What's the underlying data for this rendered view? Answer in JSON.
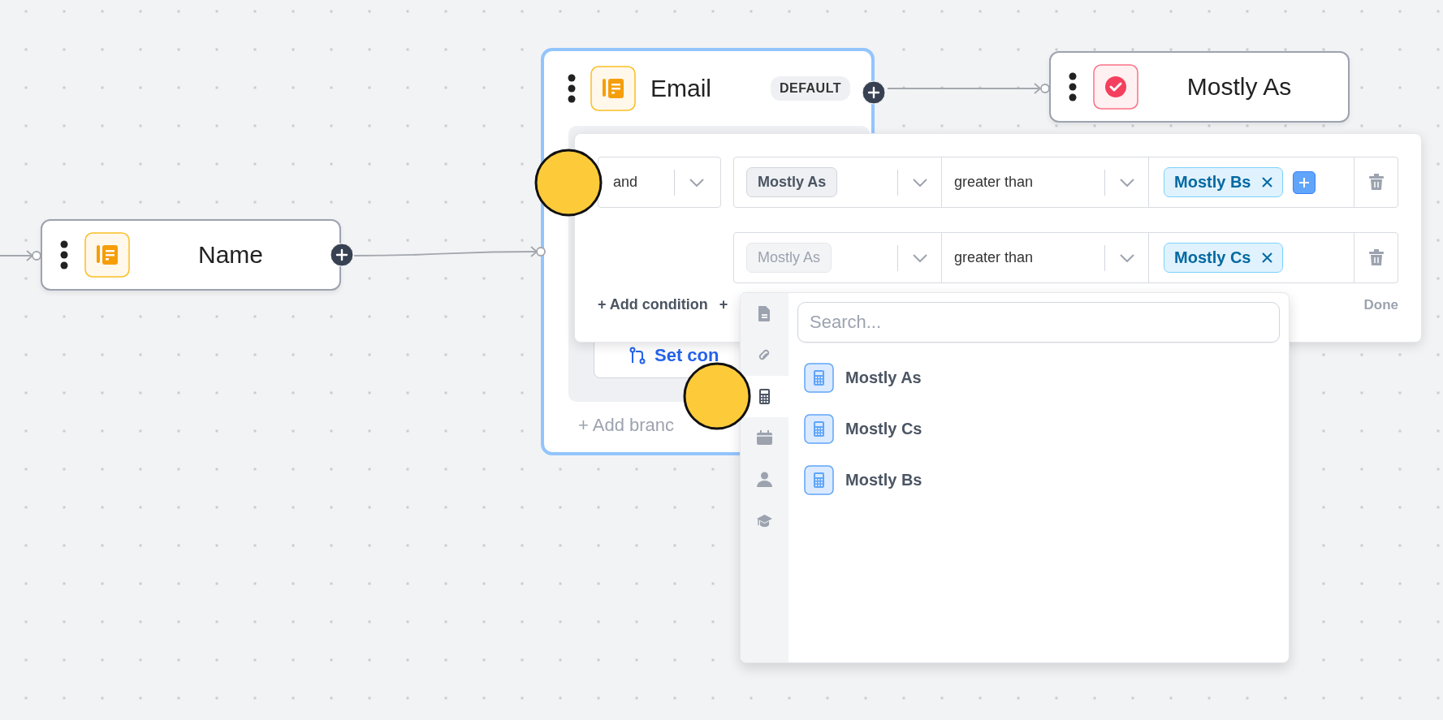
{
  "nodes": [
    {
      "kind": "form",
      "title": "Name",
      "selected": false
    },
    {
      "kind": "outcome",
      "title": "Mostly As",
      "selected": false
    }
  ],
  "branch_node": {
    "kind": "form",
    "title": "Email",
    "badge": "DEFAULT",
    "selected": true,
    "set_condition_button": "Set con",
    "add_branch": "+ Add branc"
  },
  "condition_panel": {
    "combinator": "and",
    "conditions": [
      {
        "field": "Mostly As",
        "disabled": false,
        "operator": "greater than",
        "values": [
          "Mostly Bs"
        ],
        "add_value": true
      },
      {
        "field": "Mostly As",
        "disabled": true,
        "operator": "greater than",
        "values": [
          "Mostly Cs"
        ],
        "add_value": false
      }
    ],
    "add_condition": "+ Add condition",
    "add_group": "+",
    "done": "Done"
  },
  "field_picker": {
    "search": {
      "placeholder": "Search..."
    },
    "categories": [
      {
        "kind": "document",
        "selected": false
      },
      {
        "kind": "link",
        "selected": false
      },
      {
        "kind": "calculator",
        "selected": true
      },
      {
        "kind": "calendar",
        "selected": false
      },
      {
        "kind": "person",
        "selected": false
      },
      {
        "kind": "graduation",
        "selected": false
      }
    ],
    "items": [
      {
        "kind": "calculator",
        "label": "Mostly As"
      },
      {
        "kind": "calculator",
        "label": "Mostly Cs"
      },
      {
        "kind": "calculator",
        "label": "Mostly Bs"
      }
    ]
  }
}
